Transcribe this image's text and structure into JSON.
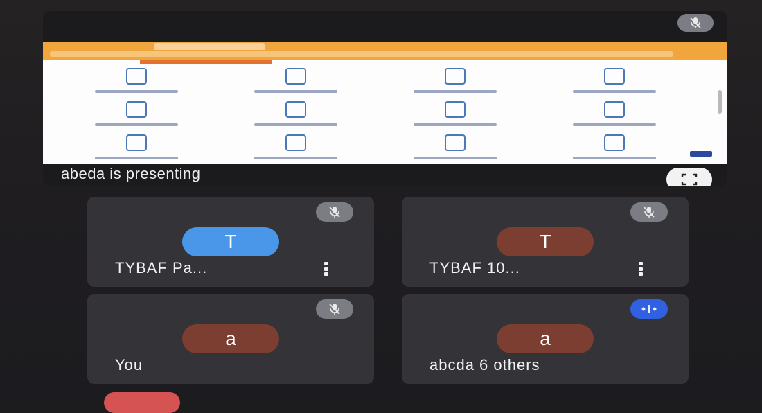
{
  "colors": {
    "background": "#1f1d20",
    "tile": "#343438",
    "mic_muted": "#7c7d84",
    "mic_speaking": "#2f61e0",
    "avatar_blue": "#4a97ea",
    "avatar_brown": "#7d3e32",
    "end_call": "#d65353"
  },
  "presentation": {
    "label": "abeda is presenting",
    "mic_icon": "mic-off-icon",
    "fullscreen_icon": "fullscreen-icon"
  },
  "participants": [
    {
      "initial": "T",
      "name": "TYBAF Pa...",
      "avatar_color": "#4a97ea",
      "mic": "muted"
    },
    {
      "initial": "T",
      "name": "TYBAF 10...",
      "avatar_color": "#7d3e32",
      "mic": "muted"
    },
    {
      "initial": "a",
      "name": "You",
      "avatar_color": "#7d3e32",
      "mic": "muted"
    },
    {
      "initial": "a",
      "name": "abcda   6 others",
      "avatar_color": "#7d3e32",
      "mic": "speaking"
    }
  ]
}
